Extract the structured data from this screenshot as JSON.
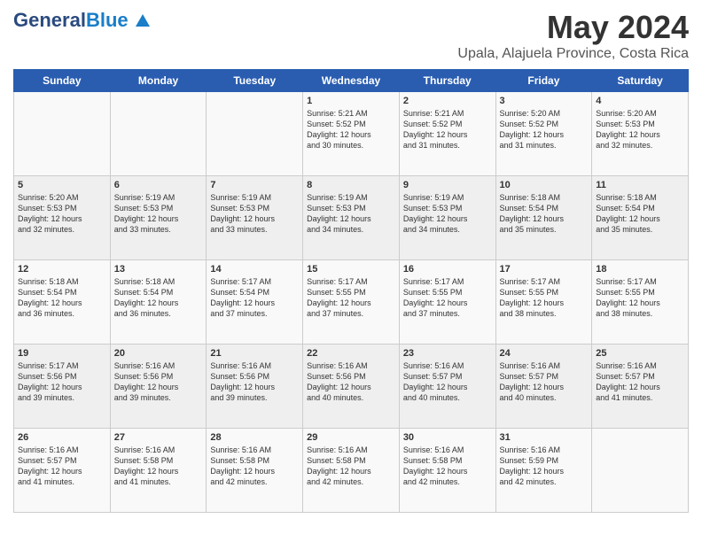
{
  "header": {
    "logo_general": "General",
    "logo_blue": "Blue",
    "title": "May 2024",
    "subtitle": "Upala, Alajuela Province, Costa Rica"
  },
  "days_of_week": [
    "Sunday",
    "Monday",
    "Tuesday",
    "Wednesday",
    "Thursday",
    "Friday",
    "Saturday"
  ],
  "weeks": [
    [
      {
        "day": "",
        "content": ""
      },
      {
        "day": "",
        "content": ""
      },
      {
        "day": "",
        "content": ""
      },
      {
        "day": "1",
        "content": "Sunrise: 5:21 AM\nSunset: 5:52 PM\nDaylight: 12 hours\nand 30 minutes."
      },
      {
        "day": "2",
        "content": "Sunrise: 5:21 AM\nSunset: 5:52 PM\nDaylight: 12 hours\nand 31 minutes."
      },
      {
        "day": "3",
        "content": "Sunrise: 5:20 AM\nSunset: 5:52 PM\nDaylight: 12 hours\nand 31 minutes."
      },
      {
        "day": "4",
        "content": "Sunrise: 5:20 AM\nSunset: 5:53 PM\nDaylight: 12 hours\nand 32 minutes."
      }
    ],
    [
      {
        "day": "5",
        "content": "Sunrise: 5:20 AM\nSunset: 5:53 PM\nDaylight: 12 hours\nand 32 minutes."
      },
      {
        "day": "6",
        "content": "Sunrise: 5:19 AM\nSunset: 5:53 PM\nDaylight: 12 hours\nand 33 minutes."
      },
      {
        "day": "7",
        "content": "Sunrise: 5:19 AM\nSunset: 5:53 PM\nDaylight: 12 hours\nand 33 minutes."
      },
      {
        "day": "8",
        "content": "Sunrise: 5:19 AM\nSunset: 5:53 PM\nDaylight: 12 hours\nand 34 minutes."
      },
      {
        "day": "9",
        "content": "Sunrise: 5:19 AM\nSunset: 5:53 PM\nDaylight: 12 hours\nand 34 minutes."
      },
      {
        "day": "10",
        "content": "Sunrise: 5:18 AM\nSunset: 5:54 PM\nDaylight: 12 hours\nand 35 minutes."
      },
      {
        "day": "11",
        "content": "Sunrise: 5:18 AM\nSunset: 5:54 PM\nDaylight: 12 hours\nand 35 minutes."
      }
    ],
    [
      {
        "day": "12",
        "content": "Sunrise: 5:18 AM\nSunset: 5:54 PM\nDaylight: 12 hours\nand 36 minutes."
      },
      {
        "day": "13",
        "content": "Sunrise: 5:18 AM\nSunset: 5:54 PM\nDaylight: 12 hours\nand 36 minutes."
      },
      {
        "day": "14",
        "content": "Sunrise: 5:17 AM\nSunset: 5:54 PM\nDaylight: 12 hours\nand 37 minutes."
      },
      {
        "day": "15",
        "content": "Sunrise: 5:17 AM\nSunset: 5:55 PM\nDaylight: 12 hours\nand 37 minutes."
      },
      {
        "day": "16",
        "content": "Sunrise: 5:17 AM\nSunset: 5:55 PM\nDaylight: 12 hours\nand 37 minutes."
      },
      {
        "day": "17",
        "content": "Sunrise: 5:17 AM\nSunset: 5:55 PM\nDaylight: 12 hours\nand 38 minutes."
      },
      {
        "day": "18",
        "content": "Sunrise: 5:17 AM\nSunset: 5:55 PM\nDaylight: 12 hours\nand 38 minutes."
      }
    ],
    [
      {
        "day": "19",
        "content": "Sunrise: 5:17 AM\nSunset: 5:56 PM\nDaylight: 12 hours\nand 39 minutes."
      },
      {
        "day": "20",
        "content": "Sunrise: 5:16 AM\nSunset: 5:56 PM\nDaylight: 12 hours\nand 39 minutes."
      },
      {
        "day": "21",
        "content": "Sunrise: 5:16 AM\nSunset: 5:56 PM\nDaylight: 12 hours\nand 39 minutes."
      },
      {
        "day": "22",
        "content": "Sunrise: 5:16 AM\nSunset: 5:56 PM\nDaylight: 12 hours\nand 40 minutes."
      },
      {
        "day": "23",
        "content": "Sunrise: 5:16 AM\nSunset: 5:57 PM\nDaylight: 12 hours\nand 40 minutes."
      },
      {
        "day": "24",
        "content": "Sunrise: 5:16 AM\nSunset: 5:57 PM\nDaylight: 12 hours\nand 40 minutes."
      },
      {
        "day": "25",
        "content": "Sunrise: 5:16 AM\nSunset: 5:57 PM\nDaylight: 12 hours\nand 41 minutes."
      }
    ],
    [
      {
        "day": "26",
        "content": "Sunrise: 5:16 AM\nSunset: 5:57 PM\nDaylight: 12 hours\nand 41 minutes."
      },
      {
        "day": "27",
        "content": "Sunrise: 5:16 AM\nSunset: 5:58 PM\nDaylight: 12 hours\nand 41 minutes."
      },
      {
        "day": "28",
        "content": "Sunrise: 5:16 AM\nSunset: 5:58 PM\nDaylight: 12 hours\nand 42 minutes."
      },
      {
        "day": "29",
        "content": "Sunrise: 5:16 AM\nSunset: 5:58 PM\nDaylight: 12 hours\nand 42 minutes."
      },
      {
        "day": "30",
        "content": "Sunrise: 5:16 AM\nSunset: 5:58 PM\nDaylight: 12 hours\nand 42 minutes."
      },
      {
        "day": "31",
        "content": "Sunrise: 5:16 AM\nSunset: 5:59 PM\nDaylight: 12 hours\nand 42 minutes."
      },
      {
        "day": "",
        "content": ""
      }
    ]
  ]
}
